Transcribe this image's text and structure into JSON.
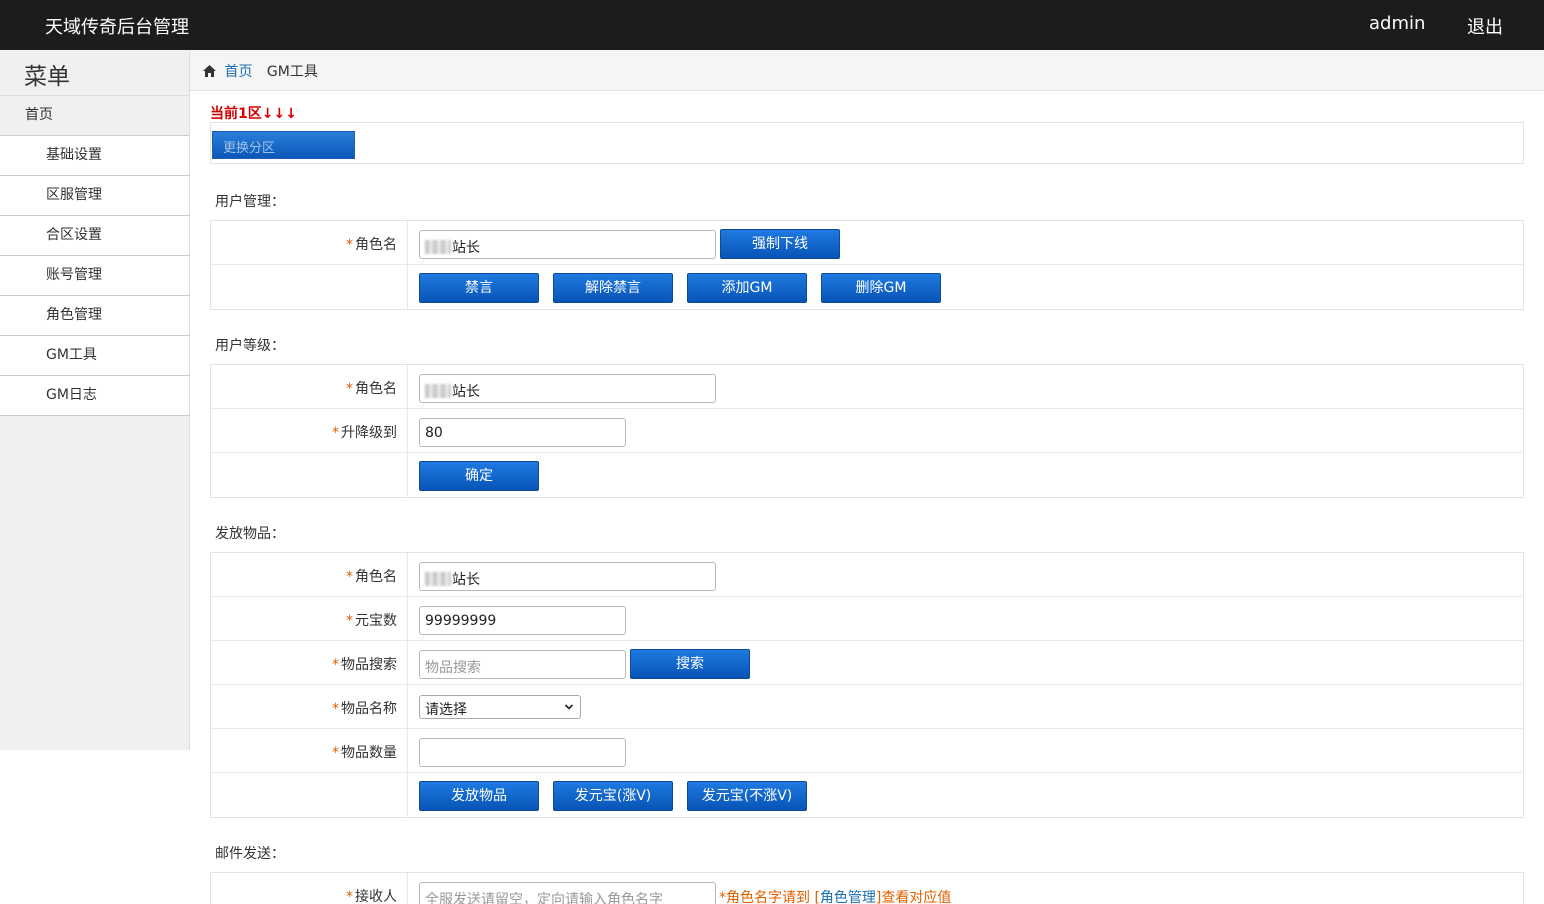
{
  "header": {
    "brand": "天域传奇后台管理",
    "user": "admin",
    "logout": "退出"
  },
  "sidebar": {
    "title": "菜单",
    "home": "首页",
    "items": [
      {
        "label": "基础设置"
      },
      {
        "label": "区服管理"
      },
      {
        "label": "合区设置"
      },
      {
        "label": "账号管理"
      },
      {
        "label": "角色管理"
      },
      {
        "label": "GM工具"
      },
      {
        "label": "GM日志"
      }
    ]
  },
  "breadcrumb": {
    "home": "首页",
    "current": "GM工具"
  },
  "zone": {
    "label": "当前1区↓↓↓",
    "change_button": "更换分区"
  },
  "user_manage": {
    "title": "用户管理：",
    "role_label": "角色名",
    "role_value": "站长",
    "kick_button": "强制下线",
    "mute_button": "禁言",
    "unmute_button": "解除禁言",
    "add_gm_button": "添加GM",
    "remove_gm_button": "删除GM"
  },
  "user_level": {
    "title": "用户等级：",
    "role_label": "角色名",
    "role_value": "站长",
    "level_label": "升降级到",
    "level_value": "80",
    "confirm_button": "确定"
  },
  "items": {
    "title": "发放物品：",
    "role_label": "角色名",
    "role_value": "站长",
    "gold_label": "元宝数",
    "gold_value": "99999999",
    "search_label": "物品搜索",
    "search_placeholder": "物品搜索",
    "search_button": "搜索",
    "name_label": "物品名称",
    "name_selected": "请选择",
    "count_label": "物品数量",
    "count_value": "",
    "send_items_button": "发放物品",
    "send_gold_up_button": "发元宝(涨V)",
    "send_gold_noup_button": "发元宝(不涨V)"
  },
  "mail": {
    "title": "邮件发送：",
    "recipient_label": "接收人",
    "recipient_placeholder": "全服发送请留空，定向请输入角色名字",
    "note_prefix": "*角色名字请到 [",
    "note_link": "角色管理",
    "note_suffix": "]查看对应值"
  },
  "star": "*"
}
